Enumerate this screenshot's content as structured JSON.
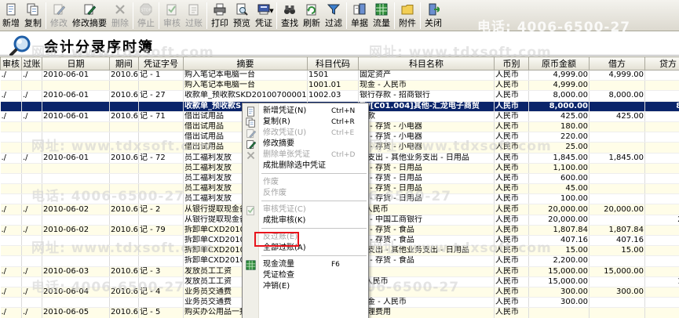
{
  "toolbar": {
    "buttons": [
      {
        "name": "new",
        "label": "新增",
        "icon": "new-doc-icon",
        "enabled": true
      },
      {
        "name": "copy",
        "label": "复制",
        "icon": "copy-icon",
        "enabled": true
      },
      {
        "name": "modify",
        "label": "修改",
        "icon": "edit-icon",
        "enabled": false
      },
      {
        "name": "modify-summary",
        "label": "修改摘要",
        "icon": "edit-summary-icon",
        "enabled": true
      },
      {
        "name": "delete",
        "label": "删除",
        "icon": "delete-icon",
        "enabled": false
      },
      {
        "name": "stop",
        "label": "停止",
        "icon": "stop-icon",
        "enabled": false
      },
      {
        "name": "audit",
        "label": "审核",
        "icon": "audit-icon",
        "enabled": false
      },
      {
        "name": "post",
        "label": "过账",
        "icon": "post-icon",
        "enabled": false
      },
      {
        "name": "print",
        "label": "打印",
        "icon": "printer-icon",
        "enabled": true
      },
      {
        "name": "preview",
        "label": "预览",
        "icon": "preview-icon",
        "enabled": true
      },
      {
        "name": "voucher",
        "label": "凭证",
        "icon": "voucher-icon",
        "enabled": true
      },
      {
        "name": "find",
        "label": "查找",
        "icon": "binoculars-icon",
        "enabled": true
      },
      {
        "name": "refresh",
        "label": "刷新",
        "icon": "refresh-icon",
        "enabled": true
      },
      {
        "name": "filter",
        "label": "过滤",
        "icon": "filter-icon",
        "enabled": true
      },
      {
        "name": "document",
        "label": "单据",
        "icon": "document-icon",
        "enabled": true
      },
      {
        "name": "flow",
        "label": "流量",
        "icon": "flow-icon",
        "enabled": true
      },
      {
        "name": "attachment",
        "label": "附件",
        "icon": "folder-icon",
        "enabled": true
      },
      {
        "name": "close",
        "label": "关闭",
        "icon": "exit-icon",
        "enabled": true
      }
    ],
    "watermark": "电话: 4006-6500-27"
  },
  "title": {
    "text": "会计分录序时簿",
    "icon": "magnifier-icon"
  },
  "columns": [
    "审核",
    "过账",
    "日期",
    "期间",
    "凭证字号",
    "摘要",
    "科目代码",
    "科目名称",
    "币别",
    "原币金额",
    "借方",
    "贷方"
  ],
  "rows": [
    [
      "./",
      "./",
      "2010-06-01",
      "2010.6",
      "记 - 1",
      "购入笔记本电脑一台",
      "1501",
      "固定资产",
      "人民币",
      "4,999.00",
      "4,999.00",
      ""
    ],
    [
      "",
      "",
      "",
      "",
      "",
      "购入笔记本电脑一台",
      "1001.01",
      "现金 - 人民币",
      "人民币",
      "4,999.00",
      "",
      "4,"
    ],
    [
      "./",
      "./",
      "2010-06-01",
      "2010.6",
      "记 - 27",
      "收款单_预收款SKD20100700001",
      "1002.03",
      "银行存款 - 招商银行",
      "人民币",
      "8,000.00",
      "8,000.00",
      ""
    ],
    [
      "",
      "",
      "",
      "",
      "",
      "收款单_预收款SKD",
      "",
      "款/[C01.004]其他-汇龙电子商贸",
      "人民币",
      "8,000.00",
      "",
      "8,0"
    ],
    [
      "./",
      "./",
      "2010-06-01",
      "2010.6",
      "记 - 71",
      "借出试用品",
      "",
      "收款",
      "人民币",
      "425.00",
      "425.00",
      ""
    ],
    [
      "",
      "",
      "",
      "",
      "",
      "借出试用品",
      "",
      "品 - 存货 - 小电器",
      "人民币",
      "180.00",
      "",
      ""
    ],
    [
      "",
      "",
      "",
      "",
      "",
      "借出试用品",
      "",
      "品 - 存货 - 小电器",
      "人民币",
      "220.00",
      "",
      ""
    ],
    [
      "",
      "",
      "",
      "",
      "",
      "借出试用品",
      "",
      "品 - 存货 - 小电器",
      "人民币",
      "25.00",
      "",
      ""
    ],
    [
      "./",
      "./",
      "2010-06-01",
      "2010.6",
      "记 - 72",
      "员工福利发放",
      "",
      "务支出 - 其他业务支出 - 日用品",
      "人民币",
      "1,845.00",
      "1,845.00",
      ""
    ],
    [
      "",
      "",
      "",
      "",
      "",
      "员工福利发放",
      "",
      "品 - 存货 - 日用品",
      "人民币",
      "1,100.00",
      "",
      "1,"
    ],
    [
      "",
      "",
      "",
      "",
      "",
      "员工福利发放",
      "",
      "品 - 存货 - 日用品",
      "人民币",
      "600.00",
      "",
      ""
    ],
    [
      "",
      "",
      "",
      "",
      "",
      "员工福利发放",
      "",
      "品 - 存货 - 日用品",
      "人民币",
      "45.00",
      "",
      ""
    ],
    [
      "",
      "",
      "",
      "",
      "",
      "员工福利发放",
      "",
      "品 - 存货 - 日用品",
      "人民币",
      "100.00",
      "",
      ""
    ],
    [
      "./",
      "./",
      "2010-06-02",
      "2010.6",
      "记 - 2",
      "从银行提取现金备",
      "",
      "- 人民币",
      "人民币",
      "20,000.00",
      "20,000.00",
      ""
    ],
    [
      "",
      "",
      "",
      "",
      "",
      "从银行提取现金备",
      "",
      "款 - 中国工商银行",
      "人民币",
      "20,000.00",
      "",
      "20,"
    ],
    [
      "./",
      "./",
      "2010-06-02",
      "2010.6",
      "记 - 79",
      "拆卸单CXD201007",
      "",
      "品 - 存货 - 食品",
      "人民币",
      "1,807.84",
      "1,807.84",
      ""
    ],
    [
      "",
      "",
      "",
      "",
      "",
      "拆卸单CXD201007",
      "",
      "品 - 存货 - 食品",
      "人民币",
      "407.16",
      "407.16",
      ""
    ],
    [
      "",
      "",
      "",
      "",
      "",
      "拆卸单CXD201007",
      "",
      "务支出 - 其他业务支出 - 日用品",
      "人民币",
      "15.00",
      "15.00",
      ""
    ],
    [
      "",
      "",
      "",
      "",
      "",
      "拆卸单CXD201007",
      "",
      "品 - 存货 - 食品",
      "人民币",
      "2,200.00",
      "",
      "2,"
    ],
    [
      "./",
      "./",
      "2010-06-03",
      "2010.6",
      "记 - 3",
      "发放员工工资",
      "",
      "资",
      "人民币",
      "15,000.00",
      "15,000.00",
      ""
    ],
    [
      "",
      "",
      "",
      "",
      "",
      "发放员工工资",
      "",
      "- 人民币",
      "人民币",
      "15,000.00",
      "",
      "15,"
    ],
    [
      "./",
      "./",
      "2010-06-04",
      "2010.6",
      "记 - 4",
      "业务员交通费",
      "",
      "",
      "人民币",
      "300.00",
      "300.00",
      ""
    ],
    [
      "",
      "",
      "",
      "",
      "",
      "业务员交通费",
      "1001.01",
      "现金 - 人民币",
      "人民币",
      "300.00",
      "",
      ""
    ],
    [
      "./",
      "./",
      "2010-06-05",
      "2010.6",
      "记 - 5",
      "购买办公用品一批",
      "5502",
      "管理费用",
      "人民币",
      "",
      "",
      ""
    ]
  ],
  "selected_row": 3,
  "watermarks": [
    "网址: www.tdxsoft.com",
    "电话: 4006-6500-27"
  ],
  "context_menu": {
    "items": [
      {
        "label": "新增凭证(N)",
        "shortcut": "Ctrl+N",
        "icon": "new-doc-icon",
        "enabled": true
      },
      {
        "label": "复制(R)",
        "shortcut": "Ctrl+R",
        "icon": "copy-icon",
        "enabled": true
      },
      {
        "label": "修改凭证(U)",
        "shortcut": "Ctrl+E",
        "icon": "edit-icon",
        "enabled": false
      },
      {
        "label": "修改摘要",
        "shortcut": "",
        "icon": "edit-summary-icon",
        "enabled": true
      },
      {
        "label": "删除单张凭证",
        "shortcut": "Ctrl+D",
        "icon": "delete-icon",
        "enabled": false
      },
      {
        "label": "成批删除选中凭证",
        "shortcut": "",
        "icon": "",
        "enabled": true
      },
      {
        "sep": true
      },
      {
        "label": "作废",
        "shortcut": "",
        "icon": "",
        "enabled": false
      },
      {
        "label": "反作废",
        "shortcut": "",
        "icon": "",
        "enabled": false
      },
      {
        "sep": true
      },
      {
        "label": "审核凭证(C)",
        "shortcut": "",
        "icon": "audit-icon",
        "enabled": false
      },
      {
        "label": "成批审核(K)",
        "shortcut": "",
        "icon": "",
        "enabled": true
      },
      {
        "sep": true
      },
      {
        "label": "反过账(E)",
        "shortcut": "",
        "icon": "",
        "enabled": false
      },
      {
        "label": "全部过账(A)",
        "shortcut": "",
        "icon": "",
        "enabled": true
      },
      {
        "sep": true
      },
      {
        "label": "现金流量",
        "shortcut": "F6",
        "icon": "flow-icon",
        "enabled": true
      },
      {
        "label": "凭证检查",
        "shortcut": "",
        "icon": "",
        "enabled": true
      },
      {
        "label": "冲销(E)",
        "shortcut": "",
        "icon": "",
        "enabled": true
      }
    ]
  },
  "colors": {
    "selection": "#0a246a",
    "highlight_box": "#e8141c",
    "row_alt": "#fffde8"
  }
}
